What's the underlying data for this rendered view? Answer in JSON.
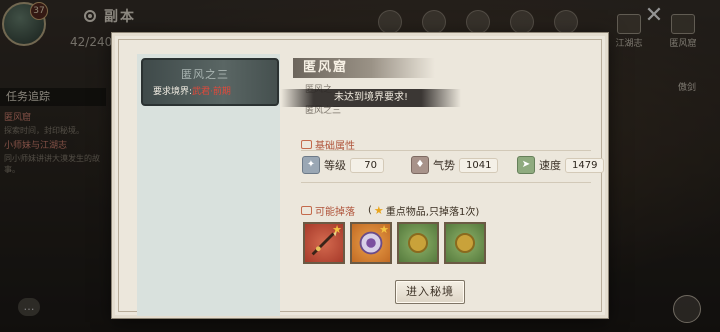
{
  "header": {
    "title": "副本",
    "energy": "42/240",
    "level_badge": "37"
  },
  "right_icons": {
    "top_right_1": "江湖志",
    "top_right_2": "匿风窟",
    "task_side": "傲剑"
  },
  "quest_panel": {
    "header": "任务追踪",
    "items": [
      {
        "title": "匿风窟",
        "desc": "探索时间，封印秘境。"
      },
      {
        "title": "小师妹与江湖志",
        "desc": "同小师妹讲讲大漠发生的故事。"
      }
    ]
  },
  "modal": {
    "dungeon_card": {
      "name": "匿风之三",
      "requirement_label": "要求境界:",
      "requirement_value": "武君·前期"
    },
    "title": "匿风窟",
    "ghost_lines": [
      "匿风之",
      "匿风之三"
    ],
    "warning": "未达到境界要求!",
    "base_attr_title": "基础属性",
    "attributes": [
      {
        "label": "等级",
        "value": "70",
        "icon": "level-icon"
      },
      {
        "label": "气势",
        "value": "1041",
        "icon": "momentum-icon"
      },
      {
        "label": "速度",
        "value": "1479",
        "icon": "speed-icon"
      }
    ],
    "drops_title": "可能掉落",
    "drops_note": "(",
    "drops_note_text": "重点物品,只掉落1次)",
    "drops": [
      {
        "name": "spear-item",
        "color": "#c24a34",
        "starred": true
      },
      {
        "name": "medallion-item",
        "color": "#d98a36",
        "starred": true
      },
      {
        "name": "coin-item",
        "color": "#7aa055",
        "starred": false
      },
      {
        "name": "scroll-item",
        "color": "#7aa055",
        "starred": false
      }
    ],
    "enter_button": "进入秘境"
  }
}
